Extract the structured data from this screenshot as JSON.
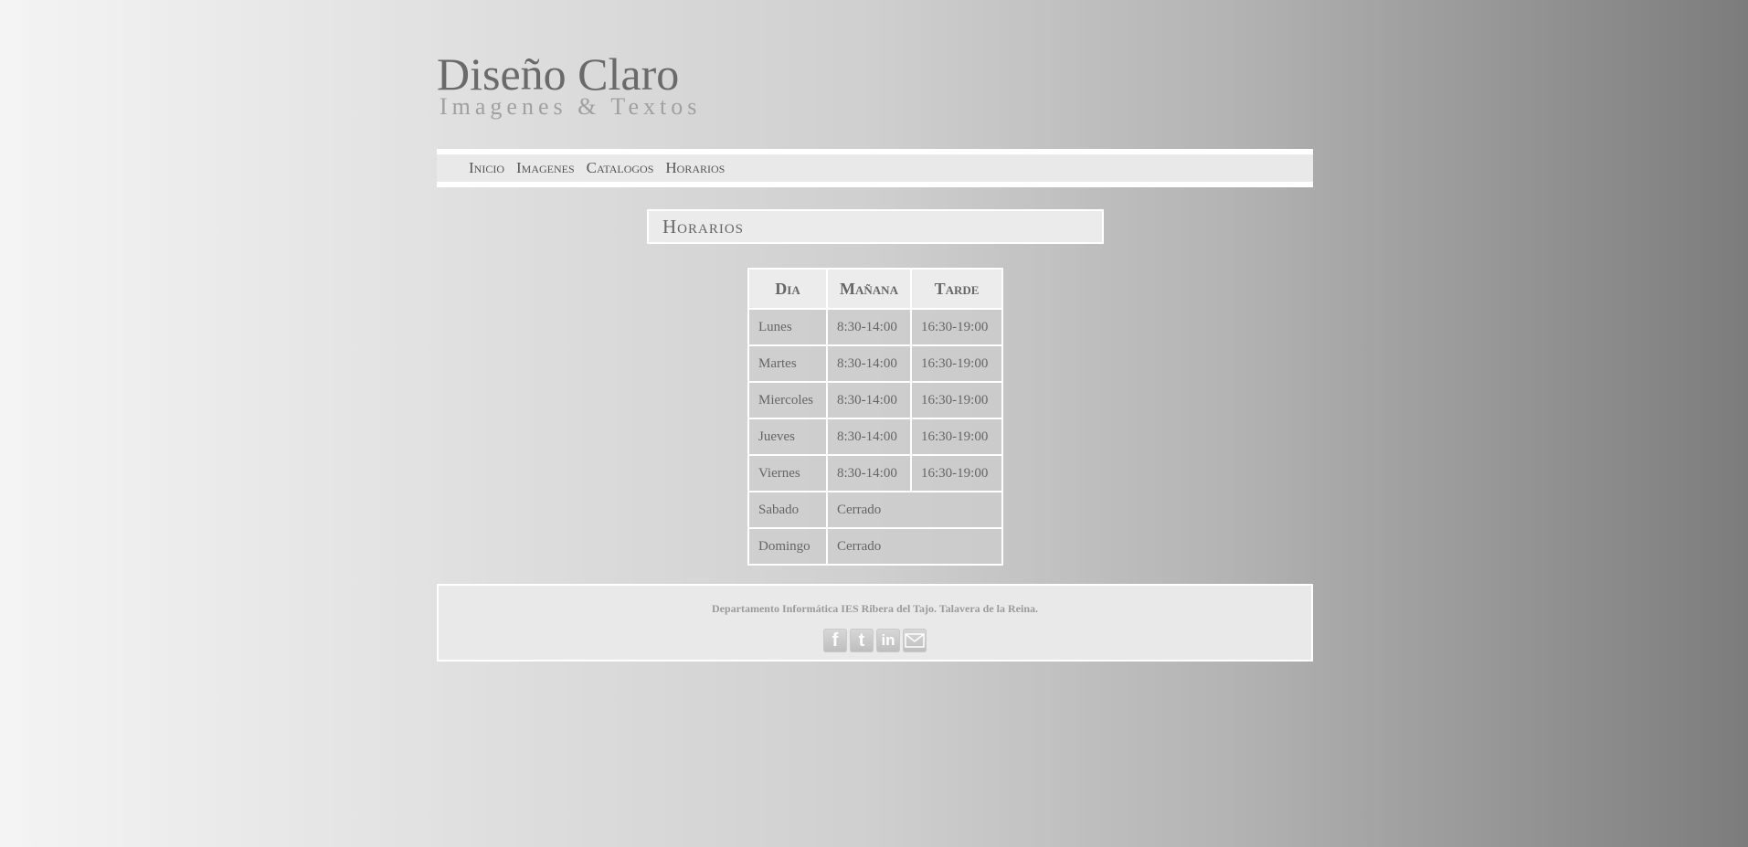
{
  "header": {
    "title": "Diseño Claro",
    "subtitle": "Imagenes & Textos"
  },
  "nav": {
    "items": [
      "Inicio",
      "Imagenes",
      "Catalogos",
      "Horarios"
    ]
  },
  "section": {
    "title": "Horarios"
  },
  "schedule": {
    "headers": [
      "Dia",
      "Mañana",
      "Tarde"
    ],
    "rows": [
      {
        "day": "Lunes",
        "morning": "8:30-14:00",
        "afternoon": "16:30-19:00"
      },
      {
        "day": "Martes",
        "morning": "8:30-14:00",
        "afternoon": "16:30-19:00"
      },
      {
        "day": "Miercoles",
        "morning": "8:30-14:00",
        "afternoon": "16:30-19:00"
      },
      {
        "day": "Jueves",
        "morning": "8:30-14:00",
        "afternoon": "16:30-19:00"
      },
      {
        "day": "Viernes",
        "morning": "8:30-14:00",
        "afternoon": "16:30-19:00"
      },
      {
        "day": "Sabado",
        "closed": "Cerrado"
      },
      {
        "day": "Domingo",
        "closed": "Cerrado"
      }
    ]
  },
  "footer": {
    "text": "Departamento Informática IES Ribera del Tajo. Talavera de la Reina.",
    "social_icons": [
      "facebook-icon",
      "twitter-icon",
      "linkedin-icon",
      "mail-icon"
    ],
    "facebook_glyph": "f",
    "twitter_glyph": "t",
    "linkedin_glyph": "in"
  }
}
